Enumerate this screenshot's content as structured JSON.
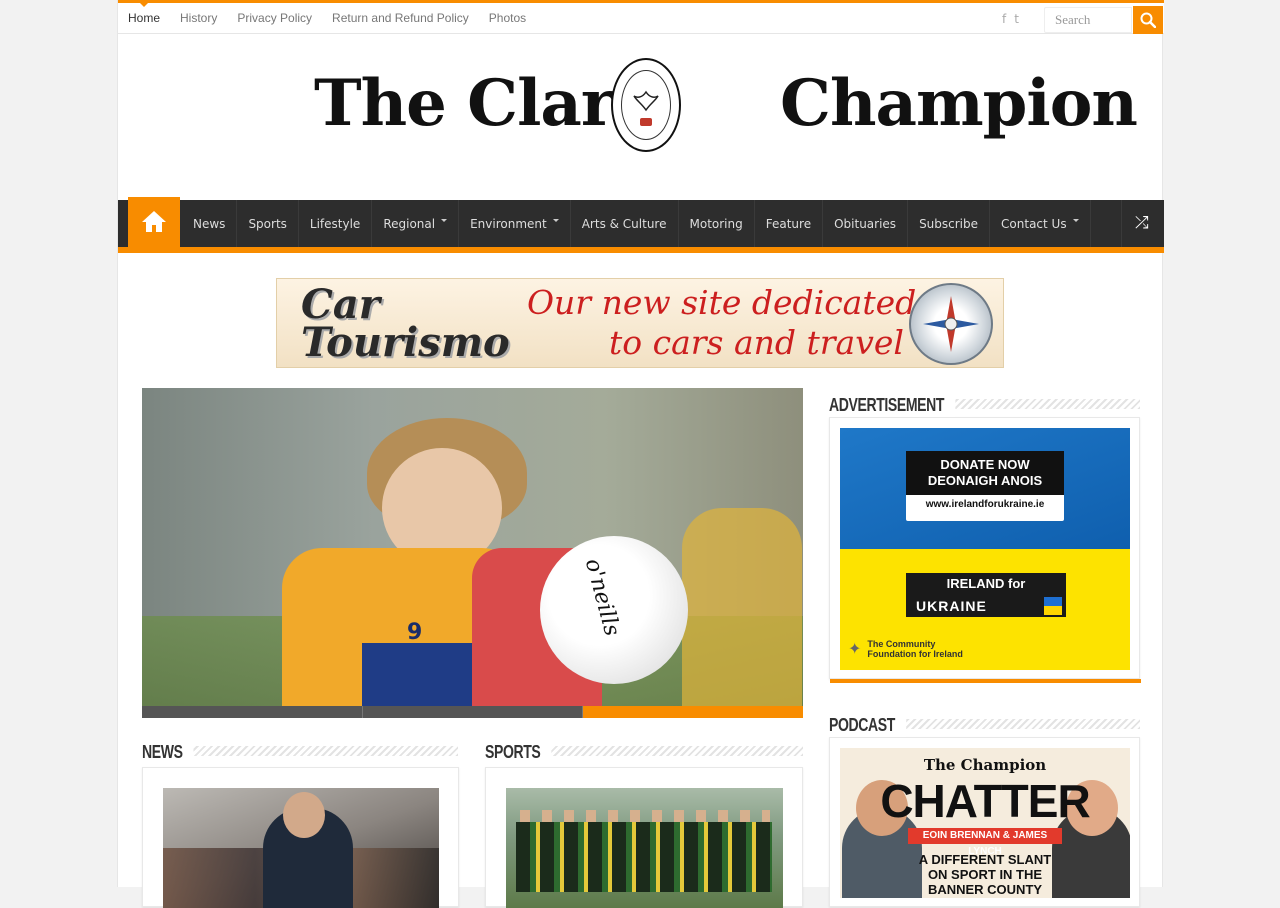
{
  "top_nav": {
    "items": [
      "Home",
      "History",
      "Privacy Policy",
      "Return and Refund Policy",
      "Photos"
    ],
    "active": "Home"
  },
  "social": {
    "facebook_icon": "facebook-icon",
    "twitter_icon": "twitter-icon"
  },
  "search": {
    "placeholder": "Search",
    "icon": "search-icon"
  },
  "logo": {
    "word1": "The Clare",
    "word2": "Champion",
    "crest_icon": "crest-emblem"
  },
  "main_nav": {
    "home_icon": "home-icon",
    "items": [
      {
        "label": "News",
        "has_dropdown": false
      },
      {
        "label": "Sports",
        "has_dropdown": false
      },
      {
        "label": "Lifestyle",
        "has_dropdown": false
      },
      {
        "label": "Regional",
        "has_dropdown": true
      },
      {
        "label": "Environment",
        "has_dropdown": true
      },
      {
        "label": "Arts & Culture",
        "has_dropdown": false
      },
      {
        "label": "Motoring",
        "has_dropdown": false
      },
      {
        "label": "Feature",
        "has_dropdown": false
      },
      {
        "label": "Obituaries",
        "has_dropdown": false
      },
      {
        "label": "Subscribe",
        "has_dropdown": false
      },
      {
        "label": "Contact Us",
        "has_dropdown": true
      }
    ],
    "random_icon": "shuffle-icon"
  },
  "banner_ad": {
    "brand_line1": "Car",
    "brand_line2": "Tourismo",
    "tagline1": "Our new site dedicated",
    "tagline2": "to cars and travel"
  },
  "slider": {
    "jersey_number": "9",
    "ball_text": "o'neills",
    "slide_count": 3,
    "active_slide": 3
  },
  "sections": {
    "news": {
      "title": "News"
    },
    "sports": {
      "title": "Sports"
    },
    "advertisement": {
      "title": "Advertisement"
    },
    "podcast": {
      "title": "Podcast"
    }
  },
  "ukraine_ad": {
    "donate_line1": "DONATE NOW",
    "donate_line2": "DEONAIGH ANOIS",
    "url": "www.irelandforukraine.ie",
    "brand_line1": "IRELAND for",
    "brand_line2": "UKRAINE",
    "foundation_line1": "The Community",
    "foundation_line2": "Foundation for Ireland"
  },
  "podcast_ad": {
    "paper": "The Champion",
    "show": "CHATTER",
    "hosts": "EOIN BRENNAN & JAMES LYNCH",
    "tagline1": "A DIFFERENT SLANT",
    "tagline2": "ON SPORT IN THE",
    "tagline3": "BANNER COUNTY"
  },
  "colors": {
    "accent": "#f88c00",
    "nav_bg": "#2d2d2d"
  }
}
